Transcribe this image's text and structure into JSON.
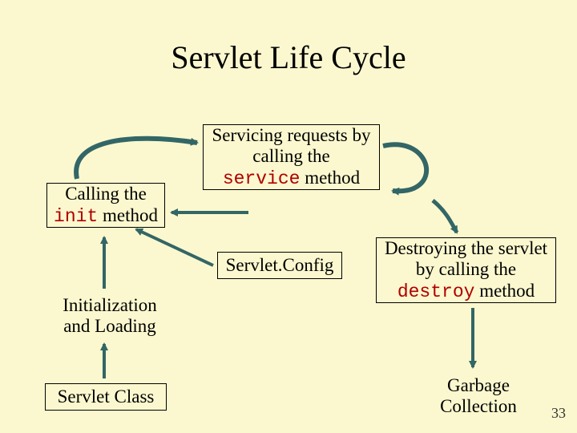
{
  "title": "Servlet Life Cycle",
  "boxes": {
    "servicing": {
      "line1": "Servicing requests by",
      "line2": "calling the",
      "code": "service",
      "after_code": " method"
    },
    "calling_init": {
      "line1": "Calling the",
      "code": "init",
      "after_code": " method"
    },
    "servlet_config": "Servlet.Config",
    "init_loading": {
      "line1": "Initialization",
      "line2": "and Loading"
    },
    "servlet_class": "Servlet Class",
    "destroying": {
      "line1": "Destroying the servlet",
      "line2": "by calling the",
      "code": "destroy",
      "after_code": " method"
    },
    "garbage": {
      "line1": "Garbage",
      "line2": "Collection"
    }
  },
  "page_number": "33",
  "arrow_color": "#336666"
}
